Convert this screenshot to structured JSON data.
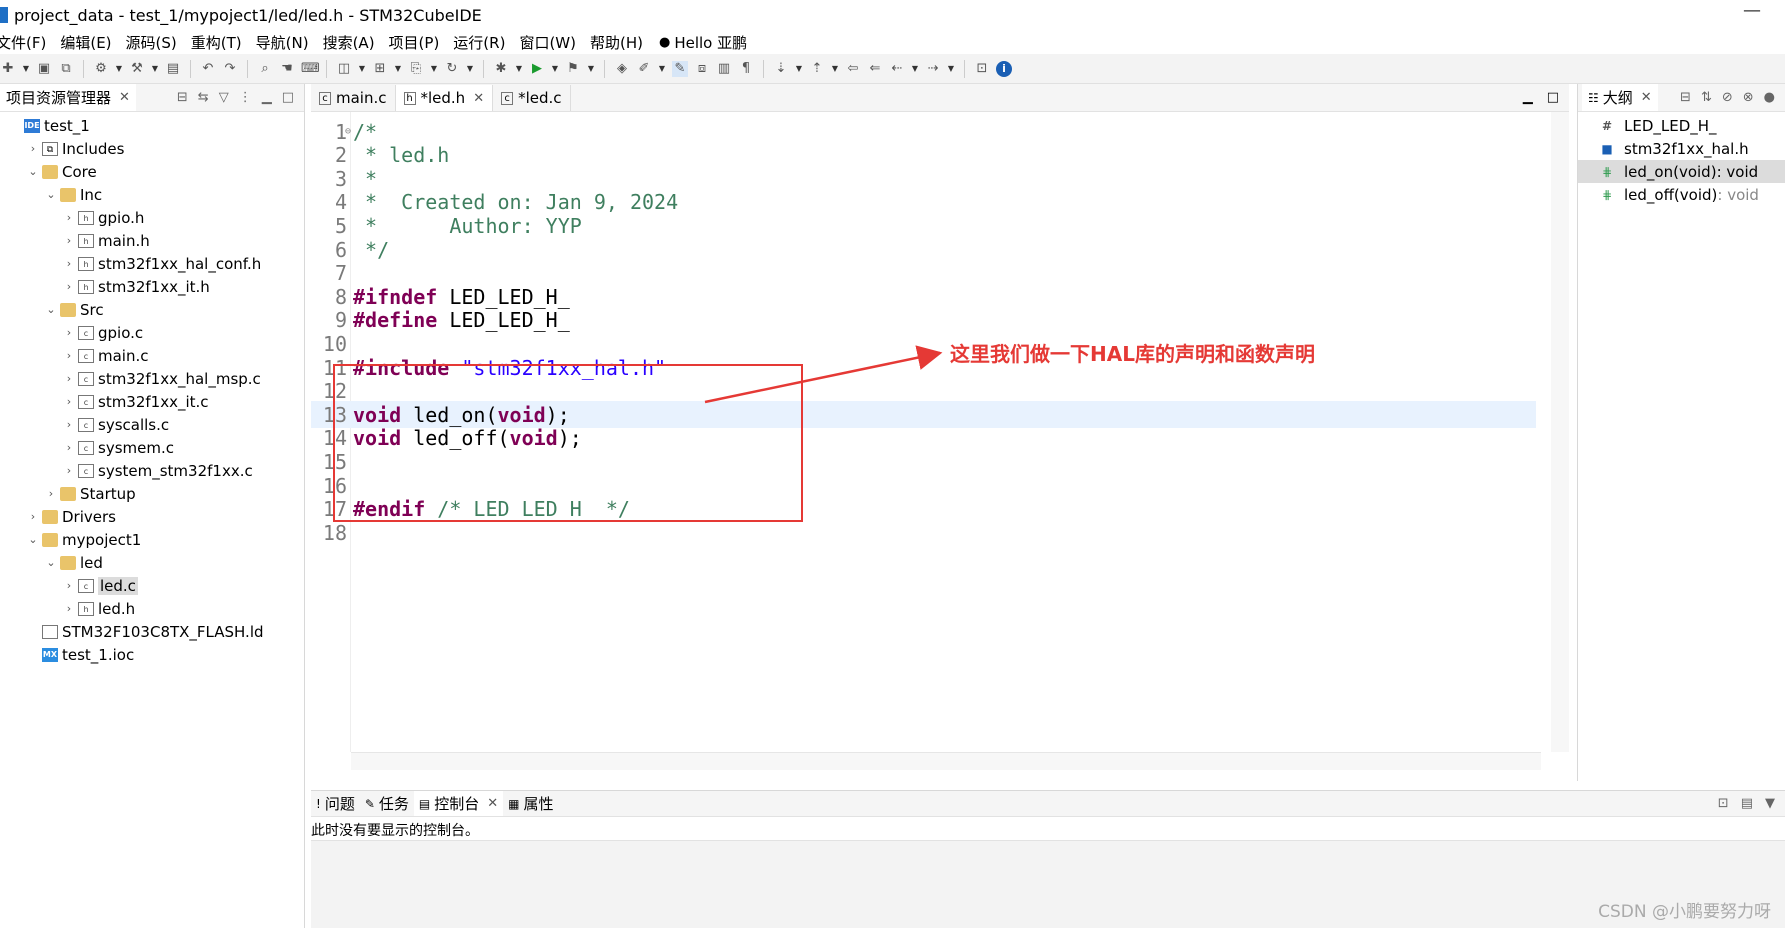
{
  "window": {
    "title": "project_data - test_1/mypoject1/led/led.h - STM32CubeIDE",
    "minimize": "—"
  },
  "menu": {
    "items": [
      "文件(F)",
      "编辑(E)",
      "源码(S)",
      "重构(T)",
      "导航(N)",
      "搜索(A)",
      "项目(P)",
      "运行(R)",
      "窗口(W)",
      "帮助(H)"
    ],
    "user": "Hello 亚鹏"
  },
  "project_explorer": {
    "title": "项目资源管理器",
    "tree": [
      {
        "label": "test_1",
        "icon": "project-icon",
        "indent": 0,
        "chev": ""
      },
      {
        "label": "Includes",
        "icon": "includes-icon",
        "indent": 1,
        "chev": "›"
      },
      {
        "label": "Core",
        "icon": "folder-icon",
        "indent": 1,
        "chev": "⌄"
      },
      {
        "label": "Inc",
        "icon": "folder-icon",
        "indent": 2,
        "chev": "⌄"
      },
      {
        "label": "gpio.h",
        "icon": "header-file-icon",
        "indent": 3,
        "chev": "›"
      },
      {
        "label": "main.h",
        "icon": "header-file-icon",
        "indent": 3,
        "chev": "›"
      },
      {
        "label": "stm32f1xx_hal_conf.h",
        "icon": "header-file-icon",
        "indent": 3,
        "chev": "›"
      },
      {
        "label": "stm32f1xx_it.h",
        "icon": "header-file-icon",
        "indent": 3,
        "chev": "›"
      },
      {
        "label": "Src",
        "icon": "folder-icon",
        "indent": 2,
        "chev": "⌄"
      },
      {
        "label": "gpio.c",
        "icon": "c-file-icon",
        "indent": 3,
        "chev": "›"
      },
      {
        "label": "main.c",
        "icon": "c-file-icon",
        "indent": 3,
        "chev": "›"
      },
      {
        "label": "stm32f1xx_hal_msp.c",
        "icon": "c-file-icon",
        "indent": 3,
        "chev": "›"
      },
      {
        "label": "stm32f1xx_it.c",
        "icon": "c-file-icon",
        "indent": 3,
        "chev": "›"
      },
      {
        "label": "syscalls.c",
        "icon": "c-file-icon",
        "indent": 3,
        "chev": "›"
      },
      {
        "label": "sysmem.c",
        "icon": "c-file-icon",
        "indent": 3,
        "chev": "›"
      },
      {
        "label": "system_stm32f1xx.c",
        "icon": "c-file-icon",
        "indent": 3,
        "chev": "›"
      },
      {
        "label": "Startup",
        "icon": "folder-icon",
        "indent": 2,
        "chev": "›"
      },
      {
        "label": "Drivers",
        "icon": "folder-icon",
        "indent": 1,
        "chev": "›"
      },
      {
        "label": "mypoject1",
        "icon": "folder-icon",
        "indent": 1,
        "chev": "⌄"
      },
      {
        "label": "led",
        "icon": "folder-icon",
        "indent": 2,
        "chev": "⌄"
      },
      {
        "label": "led.c",
        "icon": "c-file-icon",
        "indent": 3,
        "chev": "›",
        "selected": true
      },
      {
        "label": "led.h",
        "icon": "header-file-icon",
        "indent": 3,
        "chev": "›"
      },
      {
        "label": "STM32F103C8TX_FLASH.ld",
        "icon": "linker-file-icon",
        "indent": 1,
        "chev": ""
      },
      {
        "label": "test_1.ioc",
        "icon": "ioc-file-icon",
        "indent": 1,
        "chev": ""
      }
    ]
  },
  "editor": {
    "tabs": [
      {
        "label": "main.c",
        "icon": "c",
        "active": false,
        "closable": false
      },
      {
        "label": "*led.h",
        "icon": "h",
        "active": true,
        "closable": true
      },
      {
        "label": "*led.c",
        "icon": "c",
        "active": false,
        "closable": false
      }
    ],
    "lines": [
      {
        "n": "1",
        "parts": [
          {
            "t": "/*",
            "c": "comment"
          }
        ],
        "fold": "⊖"
      },
      {
        "n": "2",
        "parts": [
          {
            "t": " * led.h",
            "c": "comment"
          }
        ]
      },
      {
        "n": "3",
        "parts": [
          {
            "t": " *",
            "c": "comment"
          }
        ]
      },
      {
        "n": "4",
        "parts": [
          {
            "t": " *  Created on: Jan 9, 2024",
            "c": "comment"
          }
        ]
      },
      {
        "n": "5",
        "parts": [
          {
            "t": " *      Author: YYP",
            "c": "comment"
          }
        ]
      },
      {
        "n": "6",
        "parts": [
          {
            "t": " */",
            "c": "comment"
          }
        ]
      },
      {
        "n": "7",
        "parts": []
      },
      {
        "n": "8",
        "parts": [
          {
            "t": "#ifndef",
            "c": "kw"
          },
          {
            "t": " LED_LED_H_",
            "c": "plain"
          }
        ]
      },
      {
        "n": "9",
        "parts": [
          {
            "t": "#define",
            "c": "kw"
          },
          {
            "t": " LED_LED_H_",
            "c": "plain"
          }
        ]
      },
      {
        "n": "10",
        "parts": []
      },
      {
        "n": "11",
        "parts": [
          {
            "t": "#include",
            "c": "kw"
          },
          {
            "t": " ",
            "c": "plain"
          },
          {
            "t": "\"stm32f1xx_hal.h\"",
            "c": "str"
          }
        ]
      },
      {
        "n": "12",
        "parts": []
      },
      {
        "n": "13",
        "parts": [
          {
            "t": "void",
            "c": "kw"
          },
          {
            "t": " led_on(",
            "c": "plain"
          },
          {
            "t": "void",
            "c": "kw"
          },
          {
            "t": ");",
            "c": "plain"
          }
        ],
        "highlight": true
      },
      {
        "n": "14",
        "parts": [
          {
            "t": "void",
            "c": "kw"
          },
          {
            "t": " led_off(",
            "c": "plain"
          },
          {
            "t": "void",
            "c": "kw"
          },
          {
            "t": ");",
            "c": "plain"
          }
        ]
      },
      {
        "n": "15",
        "parts": []
      },
      {
        "n": "16",
        "parts": []
      },
      {
        "n": "17",
        "parts": [
          {
            "t": "#endif",
            "c": "kw"
          },
          {
            "t": " /* LED_LED_H_ */",
            "c": "comment"
          }
        ]
      },
      {
        "n": "18",
        "parts": []
      }
    ]
  },
  "annotation": {
    "text": "这里我们做一下HAL库的声明和函数声明",
    "color": "#e53935"
  },
  "outline": {
    "title": "大纲",
    "items": [
      {
        "icon": "#",
        "type": "hash",
        "name": "LED_LED_H_",
        "ret": ""
      },
      {
        "icon": "■",
        "type": "inc",
        "name": "stm32f1xx_hal.h",
        "ret": ""
      },
      {
        "icon": "⋕",
        "type": "fn",
        "name": "led_on(void)",
        "ret": " : void",
        "selected": true
      },
      {
        "icon": "⋕",
        "type": "fn",
        "name": "led_off(void)",
        "ret": " : void"
      }
    ]
  },
  "bottom_panel": {
    "tabs": [
      {
        "label": "问题",
        "icon": "!",
        "active": false
      },
      {
        "label": "任务",
        "icon": "✎",
        "active": false
      },
      {
        "label": "控制台",
        "icon": "▤",
        "active": true,
        "closable": true
      },
      {
        "label": "属性",
        "icon": "▦",
        "active": false
      }
    ],
    "message": "此时没有要显示的控制台。"
  },
  "watermark": "CSDN @小鹏要努力呀"
}
